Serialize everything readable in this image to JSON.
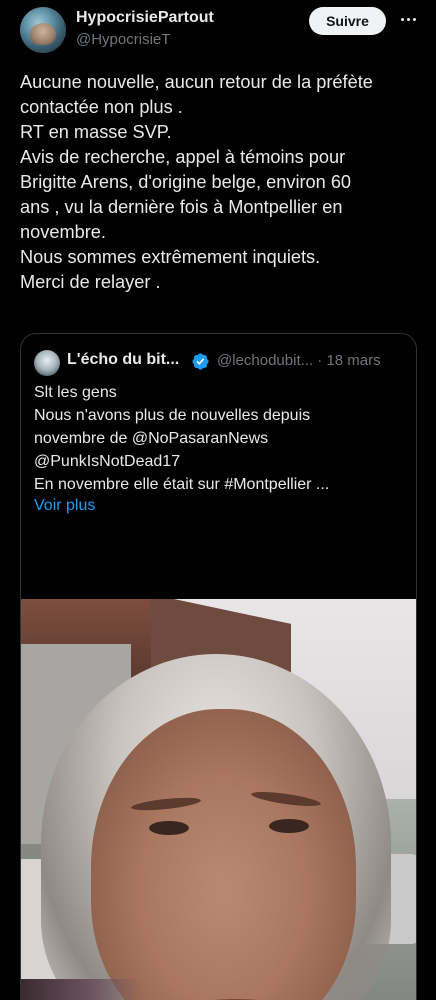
{
  "author": {
    "display_name": "HypocrisiePartout",
    "handle": "@HypocrisieT",
    "avatar_icon": "profile-avatar"
  },
  "follow_label": "Suivre",
  "more_icon": "more-horizontal-icon",
  "tweet_lines": [
    "Aucune nouvelle, aucun retour de la préfète",
    "contactée non plus .",
    "RT en masse SVP.",
    "Avis de recherche, appel à témoins pour",
    "Brigitte Arens, d'origine belge, environ 60",
    "ans , vu la dernière fois à Montpellier en",
    "novembre.",
    "Nous sommes extrêmement inquiets.",
    "Merci de relayer ."
  ],
  "quote": {
    "display_name": "L'écho du bit...",
    "handle_date": "@lechodubit... · 18 mars",
    "verified_icon": "verified-badge-icon",
    "text_lines": [
      "Slt les gens",
      "Nous n'avons plus de nouvelles depuis",
      "novembre de @NoPasaranNews",
      "@PunkIsNotDead17",
      "En novembre elle était sur #Montpellier ..."
    ],
    "show_more": "Voir plus"
  },
  "colors": {
    "background": "#000000",
    "text": "#e7e9ea",
    "secondary": "#71767b",
    "link": "#1d9bf0",
    "border": "#2f3336"
  }
}
